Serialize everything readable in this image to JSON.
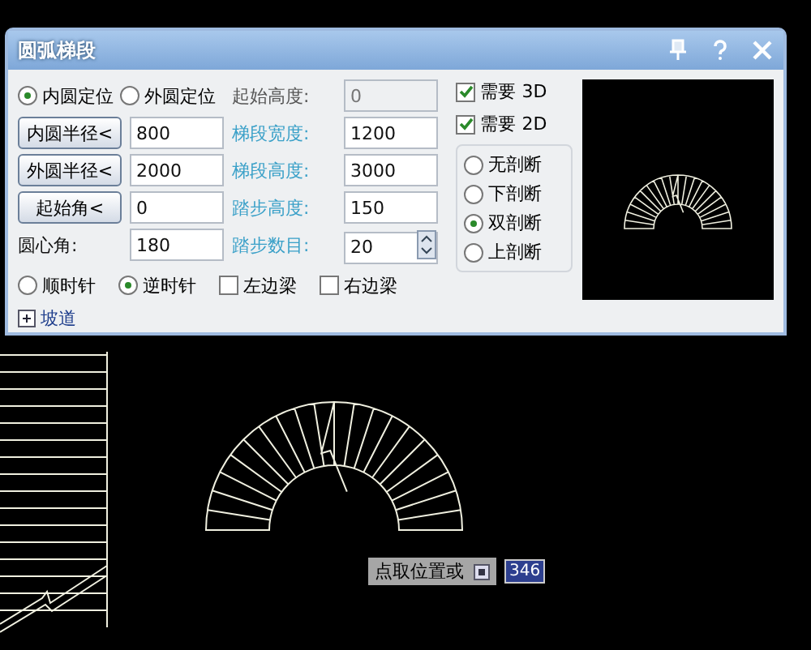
{
  "window": {
    "title": "圆弧梯段"
  },
  "position_radios": [
    {
      "label": "内圆定位",
      "selected": true
    },
    {
      "label": "外圆定位",
      "selected": false
    }
  ],
  "start_height": {
    "label": "起始高度:",
    "value": "0",
    "disabled": true
  },
  "left_fields": [
    {
      "kind": "button",
      "label": "内圆半径<",
      "value": "800"
    },
    {
      "kind": "button",
      "label": "外圆半径<",
      "value": "2000"
    },
    {
      "kind": "button",
      "label": "起始角<",
      "value": "0"
    },
    {
      "kind": "label",
      "label": "圆心角:",
      "value": "180"
    }
  ],
  "right_fields": [
    {
      "kind": "text",
      "label": "梯段宽度:",
      "value": "1200"
    },
    {
      "kind": "text",
      "label": "梯段高度:",
      "value": "3000"
    },
    {
      "kind": "text",
      "label": "踏步高度:",
      "value": "150"
    },
    {
      "kind": "spinner",
      "label": "踏步数目:",
      "value": "20"
    }
  ],
  "direction_radios": [
    {
      "label": "顺时针",
      "selected": false
    },
    {
      "label": "逆时针",
      "selected": true
    }
  ],
  "beam_checkboxes": [
    {
      "label": "左边梁",
      "checked": false
    },
    {
      "label": "右边梁",
      "checked": false
    }
  ],
  "option_checkboxes": [
    {
      "label": "需要 3D",
      "checked": true
    },
    {
      "label": "需要 2D",
      "checked": true
    }
  ],
  "section_radios": [
    {
      "label": "无剖断",
      "selected": false
    },
    {
      "label": "下剖断",
      "selected": false
    },
    {
      "label": "双剖断",
      "selected": true
    },
    {
      "label": "上剖断",
      "selected": false
    }
  ],
  "ramp": {
    "label": "坡道",
    "expanded": false
  },
  "command": {
    "prompt": "点取位置或",
    "value": "346"
  }
}
